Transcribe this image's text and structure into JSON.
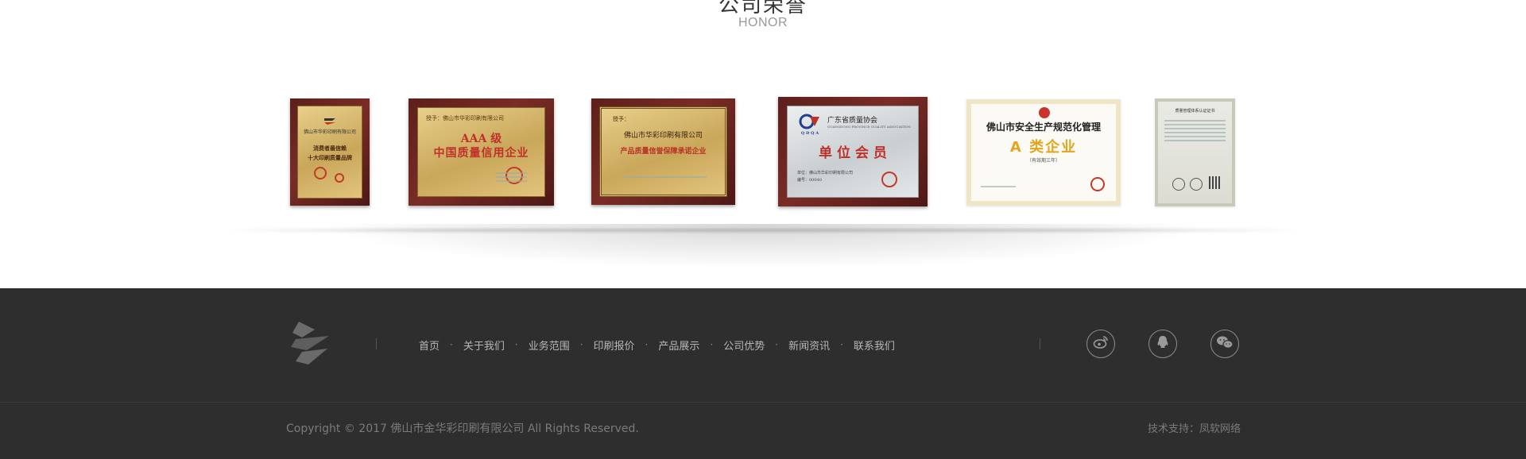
{
  "honor": {
    "title": "公司荣誉",
    "subtitle": "HONOR",
    "plaques": [
      {
        "org": "佛山市华彩印刷有限公司",
        "line1": "消费者最信赖",
        "line2": "十大印刷质量品牌"
      },
      {
        "org": "授予：佛山市华彩印刷有限公司",
        "line1": "AAA 级",
        "line2": "中国质量信用企业"
      },
      {
        "org": "授予：",
        "line1": "佛山市华彩印刷有限公司",
        "line2": "产品质量信誉保障承诺企业"
      },
      {
        "org": "广东省质量协会",
        "org_en": "GUANGDONG PROVINCE QUALITY ASSOCIATION",
        "badge": "Q D Q A",
        "line1": "单 位 会 员",
        "line2": "单位：佛山市华彩印刷有限公司",
        "line3": "编号：00040"
      },
      {
        "line1": "佛山市安全生产规范化管理",
        "line2": "A 类企业",
        "line3": "（有效期三年）"
      },
      {
        "line1": "质量管理体系认证证书"
      }
    ]
  },
  "footer": {
    "nav": [
      "首页",
      "关于我们",
      "业务范围",
      "印刷报价",
      "产品展示",
      "公司优势",
      "新闻资讯",
      "联系我们"
    ],
    "separator": "·",
    "social": [
      {
        "icon": "weibo-icon"
      },
      {
        "icon": "qq-icon"
      },
      {
        "icon": "wechat-icon"
      }
    ],
    "copyright": "Copyright © 2017 佛山市金华彩印刷有限公司 All Rights Reserved.",
    "support": "技术支持：凤软网络"
  },
  "colors": {
    "footer_bg": "#2e2e2e",
    "footer_text": "#b8b8b8",
    "title": "#333333",
    "subtitle": "#999999",
    "plaque_wood": "#6b2520",
    "certificate_red": "#c23a2a"
  }
}
